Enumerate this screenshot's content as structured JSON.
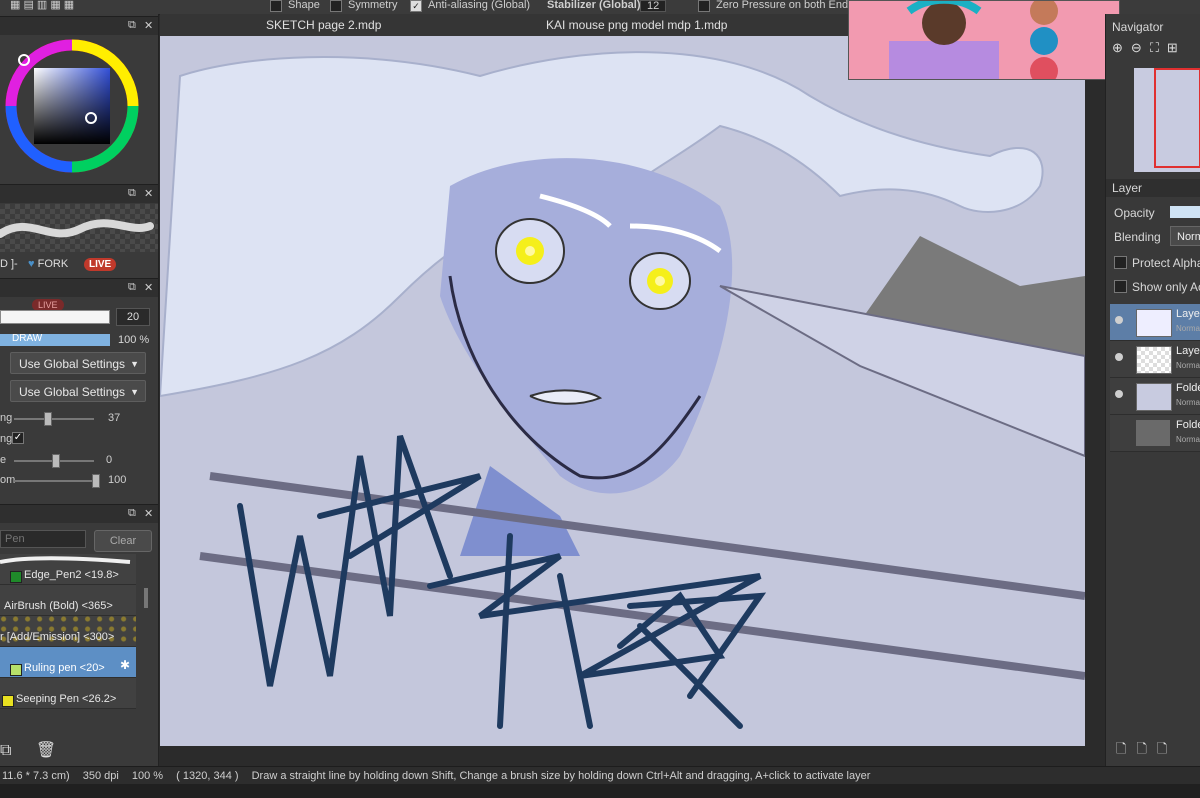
{
  "toolbar": {
    "shape": "Shape",
    "symmetry": "Symmetry",
    "antialias": "Anti-aliasing (Global)",
    "stabilizer_label": "Stabilizer (Global)",
    "stabilizer_value": "12",
    "zero_pressure": "Zero Pressure on both End"
  },
  "tabs": [
    "SKETCH page 2.mdp",
    "KAI mouse png model mdp 1.mdp"
  ],
  "left": {
    "brush_preview": {
      "rec": "D ]-",
      "fork": "FORK",
      "live": "LIVE"
    },
    "brush_settings": {
      "live": "LIVE",
      "size_value": "20",
      "draw": "DRAW",
      "opacity_value": "100 %",
      "dropdown1": "Use Global Settings",
      "dropdown2": "Use Global Settings",
      "row1_label": "ng",
      "row1_value": "37",
      "row2_label": "ng",
      "row3_label": "e",
      "row3_value": "0",
      "row4_label": "om",
      "row4_value": "100"
    },
    "brush_list": {
      "search_placeholder": "Pen",
      "clear": "Clear",
      "items": [
        {
          "name": "Edge_Pen2 <19.8>",
          "color": "#1f8a2a"
        },
        {
          "name": "AirBrush (Bold) <365>",
          "color": ""
        },
        {
          "name": "r [Add/Emission] <300>",
          "color": ""
        },
        {
          "name": "Ruling pen <20>",
          "color": "#b6e06a"
        },
        {
          "name": "Seeping Pen <26.2>",
          "color": "#e8e020"
        }
      ]
    }
  },
  "right": {
    "navigator_title": "Navigator",
    "layer_title": "Layer",
    "opacity_label": "Opacity",
    "blending_label": "Blending",
    "blending_value": "Norm",
    "protect_alpha": "Protect Alpha",
    "show_only": "Show only Ac",
    "layers": [
      {
        "name": "Laye",
        "mode": "Norma",
        "active": true,
        "visible": true
      },
      {
        "name": "Laye",
        "mode": "Norma",
        "active": false,
        "visible": true
      },
      {
        "name": "Folde",
        "mode": "Norma",
        "active": false,
        "visible": true
      },
      {
        "name": "Folde",
        "mode": "Norma",
        "active": false,
        "visible": false
      }
    ]
  },
  "canvas": {
    "scribble": "WIZARD"
  },
  "status": {
    "size": "11.6 * 7.3 cm)",
    "dpi": "350 dpi",
    "zoom": "100 %",
    "coords": "( 1320, 344 )",
    "hint": "Draw a straight line by holding down Shift, Change a brush size by holding down Ctrl+Alt and dragging, A+click to activate layer"
  },
  "colors": {
    "accent": "#5d7ea7",
    "live_red": "#c0392b",
    "fork_blue": "#4a90c8",
    "skin": "#aab3dc",
    "ink": "#1e3a5f"
  }
}
